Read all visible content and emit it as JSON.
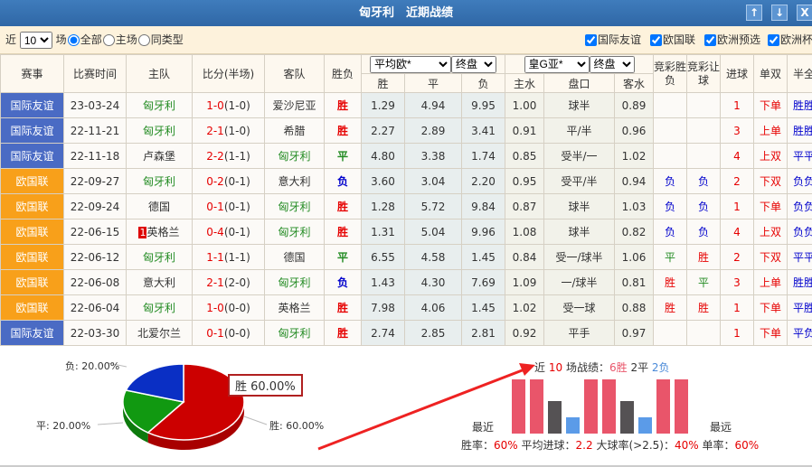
{
  "title": "匈牙利　近期战绩",
  "window_buttons": [
    "↑",
    "↓",
    "X"
  ],
  "filter": {
    "near": "近",
    "count": "10",
    "unit": "场",
    "radios": [
      "全部",
      "主场",
      "同类型"
    ],
    "selected_radio": "全部",
    "checkboxes": [
      "国际友谊",
      "欧国联",
      "欧洲预选",
      "欧洲杯"
    ]
  },
  "headers": {
    "event": "赛事",
    "time": "比赛时间",
    "home": "主队",
    "score": "比分(半场)",
    "away": "客队",
    "result": "胜负",
    "euro_select": "平均欧*",
    "euro_phase": "终盘",
    "asia_select": "皇G亚*",
    "asia_phase": "终盘",
    "w": "胜",
    "d": "平",
    "l": "负",
    "home_water": "主水",
    "handicap": "盘口",
    "away_water": "客水",
    "jc_result": "竞彩胜负",
    "jc_handicap": "竞彩让球",
    "goals": "进球",
    "odd_even": "单双",
    "ht_ft": "半全"
  },
  "rows": [
    {
      "event": "国际友谊",
      "type": "blue",
      "time": "23-03-24",
      "home": "匈牙利",
      "home_hl": true,
      "score": "1-0",
      "ht": "(1-0)",
      "away": "爱沙尼亚",
      "away_hl": false,
      "result": "胜",
      "w": "1.29",
      "d": "4.94",
      "l": "9.95",
      "hw": "1.00",
      "hc": "球半",
      "aw": "0.89",
      "jr": "",
      "jh": "",
      "goals": "1",
      "oe": "下单",
      "htft": "胜胜"
    },
    {
      "event": "国际友谊",
      "type": "blue",
      "time": "22-11-21",
      "home": "匈牙利",
      "home_hl": true,
      "score": "2-1",
      "ht": "(1-0)",
      "away": "希腊",
      "away_hl": false,
      "result": "胜",
      "w": "2.27",
      "d": "2.89",
      "l": "3.41",
      "hw": "0.91",
      "hc": "平/半",
      "aw": "0.96",
      "jr": "",
      "jh": "",
      "goals": "3",
      "oe": "上单",
      "htft": "胜胜"
    },
    {
      "event": "国际友谊",
      "type": "blue",
      "time": "22-11-18",
      "home": "卢森堡",
      "home_hl": false,
      "score": "2-2",
      "ht": "(1-1)",
      "away": "匈牙利",
      "away_hl": true,
      "result": "平",
      "w": "4.80",
      "d": "3.38",
      "l": "1.74",
      "hw": "0.85",
      "hc": "受半/一",
      "aw": "1.02",
      "jr": "",
      "jh": "",
      "goals": "4",
      "oe": "上双",
      "htft": "平平"
    },
    {
      "event": "欧国联",
      "type": "orange",
      "time": "22-09-27",
      "home": "匈牙利",
      "home_hl": true,
      "score": "0-2",
      "ht": "(0-1)",
      "away": "意大利",
      "away_hl": false,
      "result": "负",
      "w": "3.60",
      "d": "3.04",
      "l": "2.20",
      "hw": "0.95",
      "hc": "受平/半",
      "aw": "0.94",
      "jr": "负",
      "jh": "负",
      "goals": "2",
      "oe": "下双",
      "htft": "负负"
    },
    {
      "event": "欧国联",
      "type": "orange",
      "time": "22-09-24",
      "home": "德国",
      "home_hl": false,
      "score": "0-1",
      "ht": "(0-1)",
      "away": "匈牙利",
      "away_hl": true,
      "result": "胜",
      "w": "1.28",
      "d": "5.72",
      "l": "9.84",
      "hw": "0.87",
      "hc": "球半",
      "aw": "1.03",
      "jr": "负",
      "jh": "负",
      "goals": "1",
      "oe": "下单",
      "htft": "负负"
    },
    {
      "event": "欧国联",
      "type": "orange",
      "time": "22-06-15",
      "home": "英格兰",
      "home_rank": "1",
      "home_hl": false,
      "score": "0-4",
      "ht": "(0-1)",
      "away": "匈牙利",
      "away_hl": true,
      "result": "胜",
      "w": "1.31",
      "d": "5.04",
      "l": "9.96",
      "hw": "1.08",
      "hc": "球半",
      "aw": "0.82",
      "jr": "负",
      "jh": "负",
      "goals": "4",
      "oe": "上双",
      "htft": "负负"
    },
    {
      "event": "欧国联",
      "type": "orange",
      "time": "22-06-12",
      "home": "匈牙利",
      "home_hl": true,
      "score": "1-1",
      "ht": "(1-1)",
      "away": "德国",
      "away_hl": false,
      "result": "平",
      "w": "6.55",
      "d": "4.58",
      "l": "1.45",
      "hw": "0.84",
      "hc": "受一/球半",
      "aw": "1.06",
      "jr": "平",
      "jh": "胜",
      "goals": "2",
      "oe": "下双",
      "htft": "平平"
    },
    {
      "event": "欧国联",
      "type": "orange",
      "time": "22-06-08",
      "home": "意大利",
      "home_hl": false,
      "score": "2-1",
      "ht": "(2-0)",
      "away": "匈牙利",
      "away_hl": true,
      "result": "负",
      "w": "1.43",
      "d": "4.30",
      "l": "7.69",
      "hw": "1.09",
      "hc": "一/球半",
      "aw": "0.81",
      "jr": "胜",
      "jh": "平",
      "goals": "3",
      "oe": "上单",
      "htft": "胜胜"
    },
    {
      "event": "欧国联",
      "type": "orange",
      "time": "22-06-04",
      "home": "匈牙利",
      "home_hl": true,
      "score": "1-0",
      "ht": "(0-0)",
      "away": "英格兰",
      "away_hl": false,
      "result": "胜",
      "w": "7.98",
      "d": "4.06",
      "l": "1.45",
      "hw": "1.02",
      "hc": "受一球",
      "aw": "0.88",
      "jr": "胜",
      "jh": "胜",
      "goals": "1",
      "oe": "下单",
      "htft": "平胜"
    },
    {
      "event": "国际友谊",
      "type": "blue",
      "time": "22-03-30",
      "home": "北爱尔兰",
      "home_hl": false,
      "score": "0-1",
      "ht": "(0-0)",
      "away": "匈牙利",
      "away_hl": true,
      "result": "胜",
      "w": "2.74",
      "d": "2.85",
      "l": "2.81",
      "hw": "0.92",
      "hc": "平手",
      "aw": "0.97",
      "jr": "",
      "jh": "",
      "goals": "1",
      "oe": "下单",
      "htft": "平负"
    }
  ],
  "pie": {
    "tooltip": "胜 60.00%",
    "labels": {
      "win": "胜: 60.00%",
      "draw": "平: 20.00%",
      "loss": "负: 20.00%"
    },
    "values": {
      "win": 60,
      "draw": 20,
      "loss": 20
    },
    "colors": {
      "win": "#cc0000",
      "draw": "#119911",
      "loss": "#0a2fc4"
    }
  },
  "summary": {
    "prefix": "近",
    "count": "10",
    "mid": "场战绩：",
    "wins": "6胜",
    "draws": "2平",
    "losses": "2负",
    "left_label": "最近",
    "right_label": "最远",
    "sequence": [
      "W",
      "W",
      "D",
      "L",
      "W",
      "W",
      "D",
      "L",
      "W",
      "W"
    ],
    "colors": {
      "W": "#e9556a",
      "D": "#555254",
      "L": "#5b9be8"
    },
    "stats": {
      "win_rate_label": "胜率：",
      "win_rate": "60%",
      "avg_goals_label": "平均进球：",
      "avg_goals": "2.2",
      "big_label": "大球率(>2.5)：",
      "big": "40%",
      "odd_label": "单率：",
      "odd": "60%"
    }
  }
}
